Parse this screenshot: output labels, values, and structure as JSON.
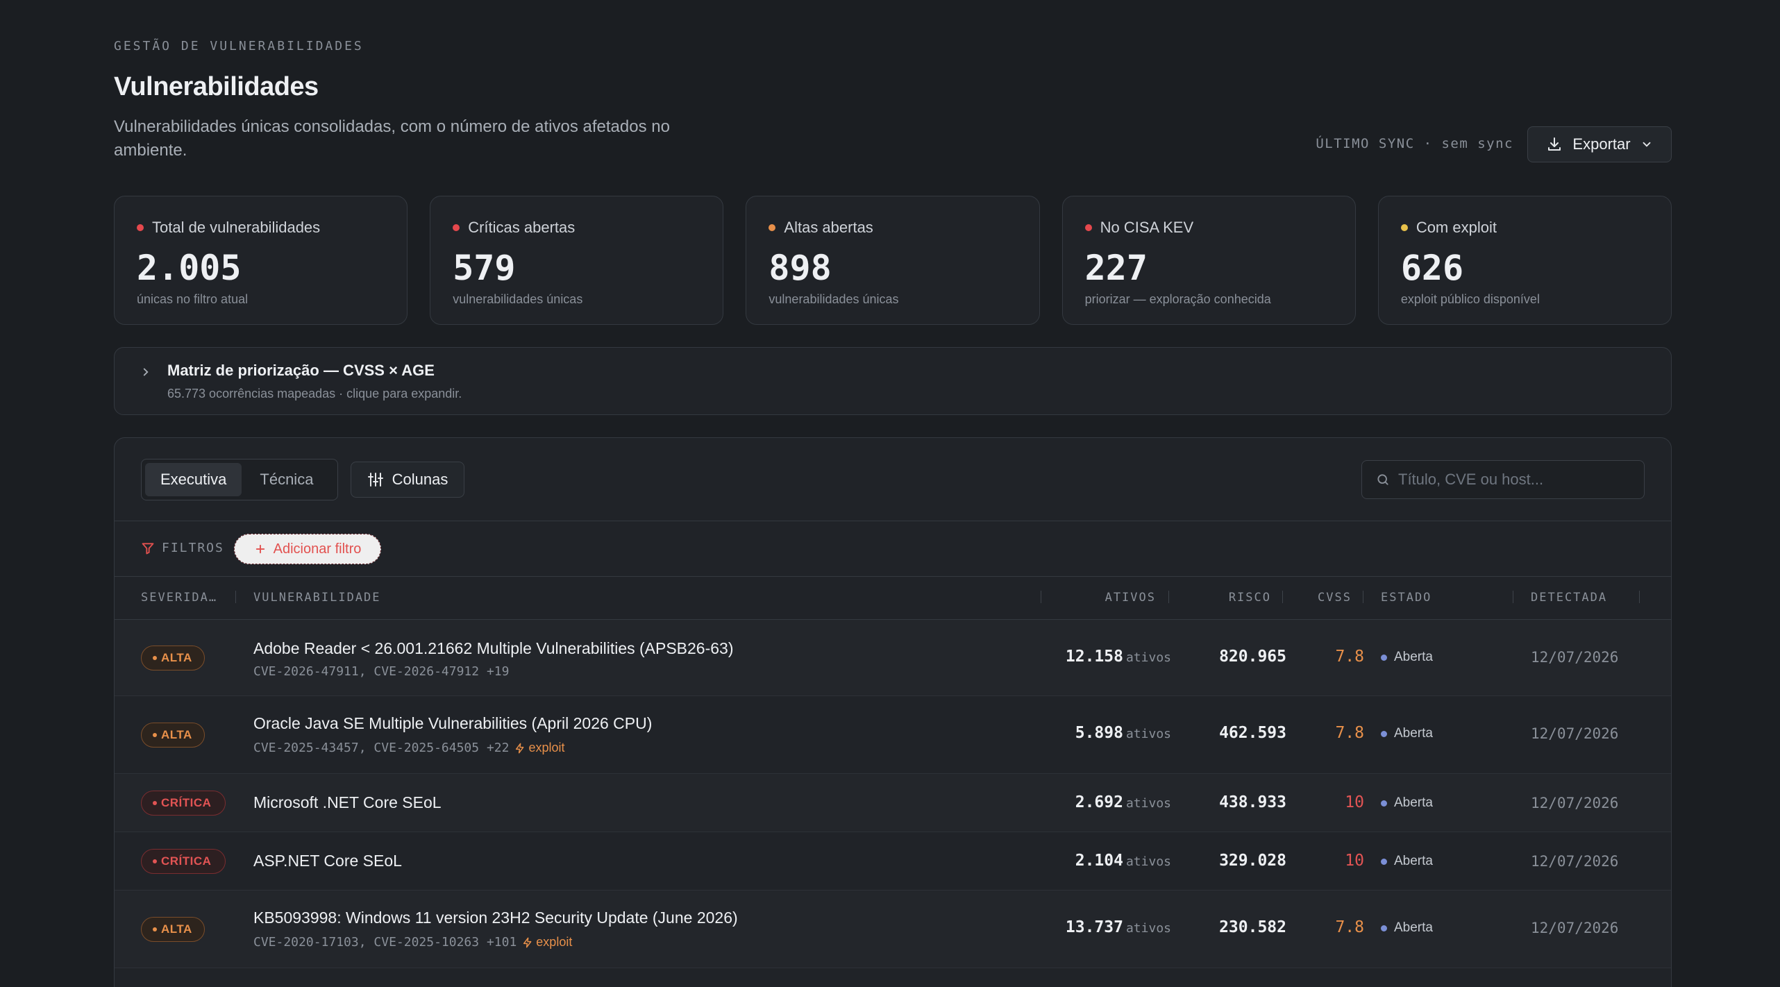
{
  "header": {
    "eyebrow": "GESTÃO DE VULNERABILIDADES",
    "title": "Vulnerabilidades",
    "subtitle": "Vulnerabilidades únicas consolidadas, com o número de ativos afetados no ambiente.",
    "sync_label": "ÚLTIMO SYNC · sem sync",
    "export_label": "Exportar"
  },
  "stats": [
    {
      "label": "Total de vulnerabilidades",
      "value": "2.005",
      "hint": "únicas no filtro atual",
      "color": "#e5484d"
    },
    {
      "label": "Críticas abertas",
      "value": "579",
      "hint": "vulnerabilidades únicas",
      "color": "#e5484d"
    },
    {
      "label": "Altas abertas",
      "value": "898",
      "hint": "vulnerabilidades únicas",
      "color": "#e8904a"
    },
    {
      "label": "No CISA KEV",
      "value": "227",
      "hint": "priorizar — exploração conhecida",
      "color": "#e5484d"
    },
    {
      "label": "Com exploit",
      "value": "626",
      "hint": "exploit público disponível",
      "color": "#e8c14a"
    }
  ],
  "matrix": {
    "title": "Matriz de priorização — CVSS × AGE",
    "subtitle": "65.773 ocorrências mapeadas · clique para expandir."
  },
  "toolbar": {
    "view_executive": "Executiva",
    "view_technical": "Técnica",
    "columns_label": "Colunas",
    "search_placeholder": "Título, CVE ou host..."
  },
  "filters": {
    "label": "FILTROS",
    "add_label": "Adicionar filtro"
  },
  "table": {
    "headers": {
      "severity": "SEVERIDA…",
      "vulnerability": "VULNERABILIDADE",
      "assets": "ATIVOS",
      "risk": "RISCO",
      "cvss": "CVSS",
      "state": "ESTADO",
      "detected": "DETECTADA"
    },
    "assets_suffix": "ativos",
    "exploit_label": "exploit",
    "rows": [
      {
        "severity": "ALTA",
        "title": "Adobe Reader < 26.001.21662 Multiple Vulnerabilities (APSB26-63)",
        "cves": "CVE-2026-47911, CVE-2026-47912 +19",
        "exploit": false,
        "assets": "12.158",
        "risk": "820.965",
        "cvss": "7.8",
        "state": "Aberta",
        "detected": "12/07/2026"
      },
      {
        "severity": "ALTA",
        "title": "Oracle Java SE Multiple Vulnerabilities (April 2026 CPU)",
        "cves": "CVE-2025-43457, CVE-2025-64505 +22",
        "exploit": true,
        "assets": "5.898",
        "risk": "462.593",
        "cvss": "7.8",
        "state": "Aberta",
        "detected": "12/07/2026"
      },
      {
        "severity": "CRÍTICA",
        "title": "Microsoft .NET Core SEoL",
        "cves": "",
        "exploit": false,
        "assets": "2.692",
        "risk": "438.933",
        "cvss": "10",
        "state": "Aberta",
        "detected": "12/07/2026"
      },
      {
        "severity": "CRÍTICA",
        "title": "ASP.NET Core SEoL",
        "cves": "",
        "exploit": false,
        "assets": "2.104",
        "risk": "329.028",
        "cvss": "10",
        "state": "Aberta",
        "detected": "12/07/2026"
      },
      {
        "severity": "ALTA",
        "title": "KB5093998: Windows 11 version 23H2 Security Update (June 2026)",
        "cves": "CVE-2020-17103, CVE-2025-10263 +101",
        "exploit": true,
        "assets": "13.737",
        "risk": "230.582",
        "cvss": "7.8",
        "state": "Aberta",
        "detected": "12/07/2026"
      }
    ]
  },
  "colors": {
    "alta": "#e8904a",
    "critica": "#e25454",
    "estado_dot": "#7b8fd6",
    "accent_red": "#e2514f"
  }
}
